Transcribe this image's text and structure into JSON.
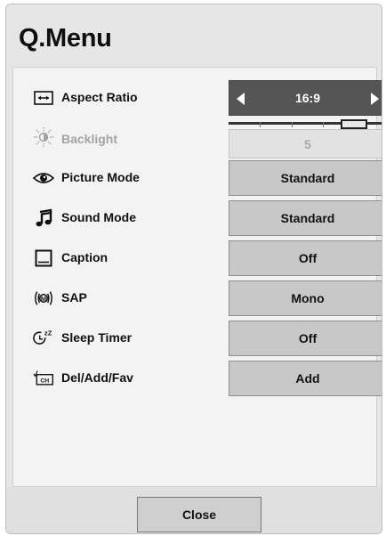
{
  "menu": {
    "title": "Q.Menu"
  },
  "items": [
    {
      "label": "Aspect Ratio",
      "value": "16:9",
      "icon": "aspect-ratio-icon"
    },
    {
      "label": "Backlight",
      "value": "5",
      "icon": "backlight-icon"
    },
    {
      "label": "Picture Mode",
      "value": "Standard",
      "icon": "eye-icon"
    },
    {
      "label": "Sound Mode",
      "value": "Standard",
      "icon": "music-note-icon"
    },
    {
      "label": "Caption",
      "value": "Off",
      "icon": "caption-icon"
    },
    {
      "label": "SAP",
      "value": "Mono",
      "icon": "sap-icon"
    },
    {
      "label": "Sleep Timer",
      "value": "Off",
      "icon": "sleep-timer-icon"
    },
    {
      "label": "Del/Add/Fav",
      "value": "Add",
      "icon": "channel-icon"
    }
  ],
  "icon_text": {
    "sap": "M",
    "sleep_zz": "zZ",
    "channel": "CH"
  },
  "backlight_slider": {
    "value_fraction": 0.75
  },
  "footer": {
    "close_label": "Close"
  },
  "colors": {
    "selected_bg": "#555555",
    "value_bg": "#c8c8c8",
    "panel_bg": "#e6e6e6"
  }
}
